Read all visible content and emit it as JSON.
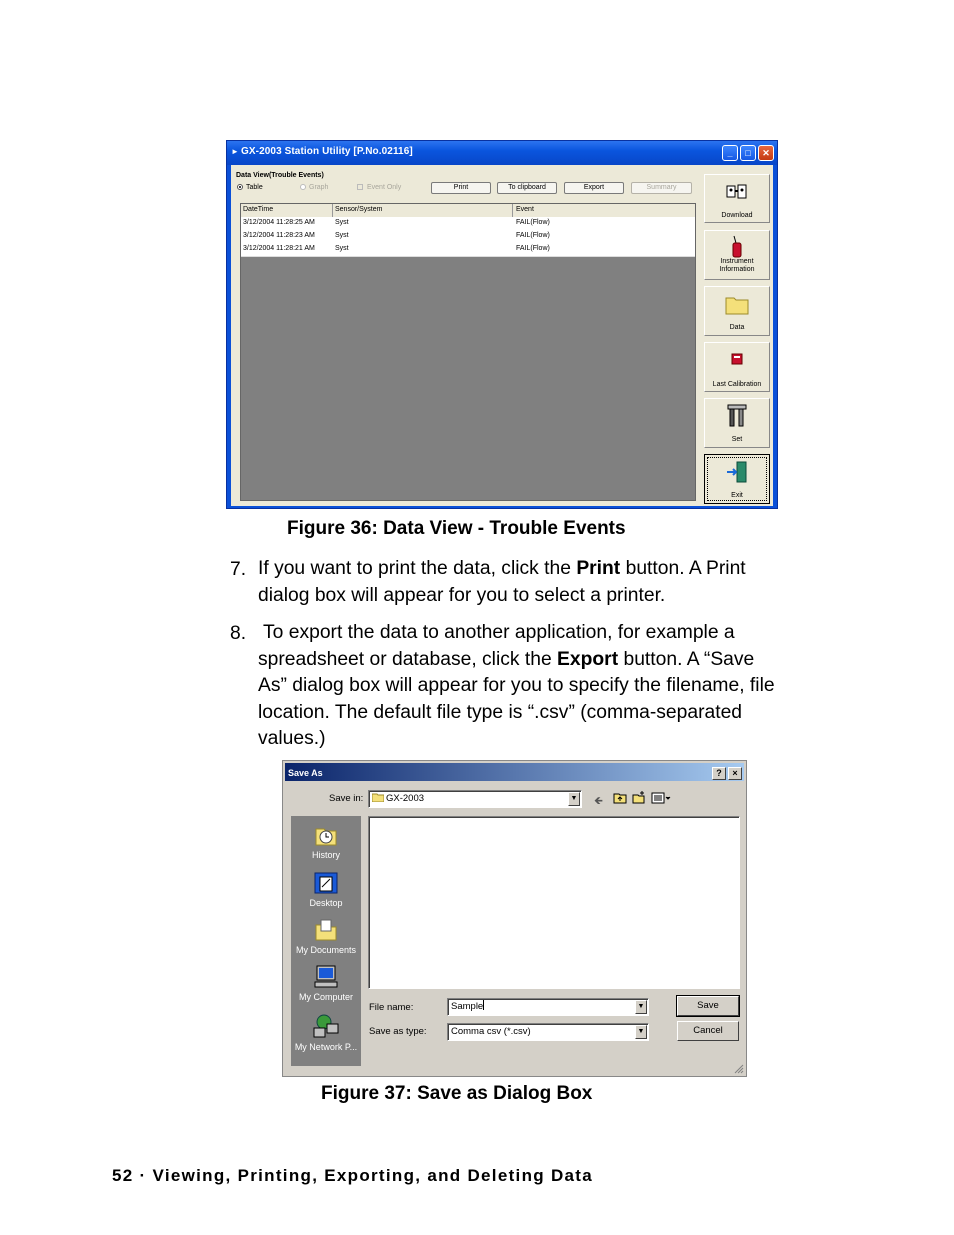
{
  "figure36": {
    "window_title": "GX-2003 Station Utility [P.No.02116]",
    "group_label": "Data View(Trouble Events)",
    "view_options": {
      "table": "Table",
      "graph": "Graph",
      "event_only": "Event Only"
    },
    "buttons": {
      "print": "Print",
      "to_clipboard": "To clipboard",
      "export": "Export",
      "summary": "Summary"
    },
    "table": {
      "columns": [
        "DateTime",
        "Sensor/System",
        "Event"
      ],
      "rows": [
        [
          "3/12/2004 11:28:25 AM",
          "Syst",
          "FAIL(Flow)"
        ],
        [
          "3/12/2004 11:28:23 AM",
          "Syst",
          "FAIL(Flow)"
        ],
        [
          "3/12/2004 11:28:21 AM",
          "Syst",
          "FAIL(Flow)"
        ]
      ]
    },
    "side_buttons": {
      "download": "Download",
      "instrument_information_line1": "Instrument",
      "instrument_information_line2": "Information",
      "data": "Data",
      "last_calibration": "Last Calibration",
      "set": "Set",
      "exit": "Exit"
    },
    "caption": "Figure 36:  Data View - Trouble Events"
  },
  "instructions": {
    "step7_number": "7.",
    "step7_line1_pre": "If you want to print the data, click the ",
    "step7_line1_bold": "Print",
    "step7_line1_post": " button. A Print",
    "step7_line2": "dialog box will appear for you to select a printer.",
    "step8_number": "8.",
    "step8_line1": " To export the data to another application, for example a",
    "step8_line2_pre": "spreadsheet or database, click the ",
    "step8_line2_bold": "Export",
    "step8_line2_post": " button. A “Save",
    "step8_line3": "As” dialog box will appear for you to specify the filename, file",
    "step8_line4": "location. The default file type is “.csv” (comma-separated",
    "step8_line5": "values.)"
  },
  "figure37": {
    "window_title": "Save As",
    "help_button": "?",
    "close_button": "×",
    "save_in_label": "Save in:",
    "save_in_value": "GX-2003",
    "places": [
      "History",
      "Desktop",
      "My Documents",
      "My Computer",
      "My Network P..."
    ],
    "file_name_label": "File name:",
    "file_name_value": "Sample",
    "save_as_type_label": "Save as type:",
    "save_as_type_value": "Comma csv (*.csv)",
    "save_button": "Save",
    "cancel_button": "Cancel",
    "caption": "Figure 37:  Save as Dialog Box"
  },
  "footer": "52 · Viewing, Printing, Exporting, and Deleting Data"
}
